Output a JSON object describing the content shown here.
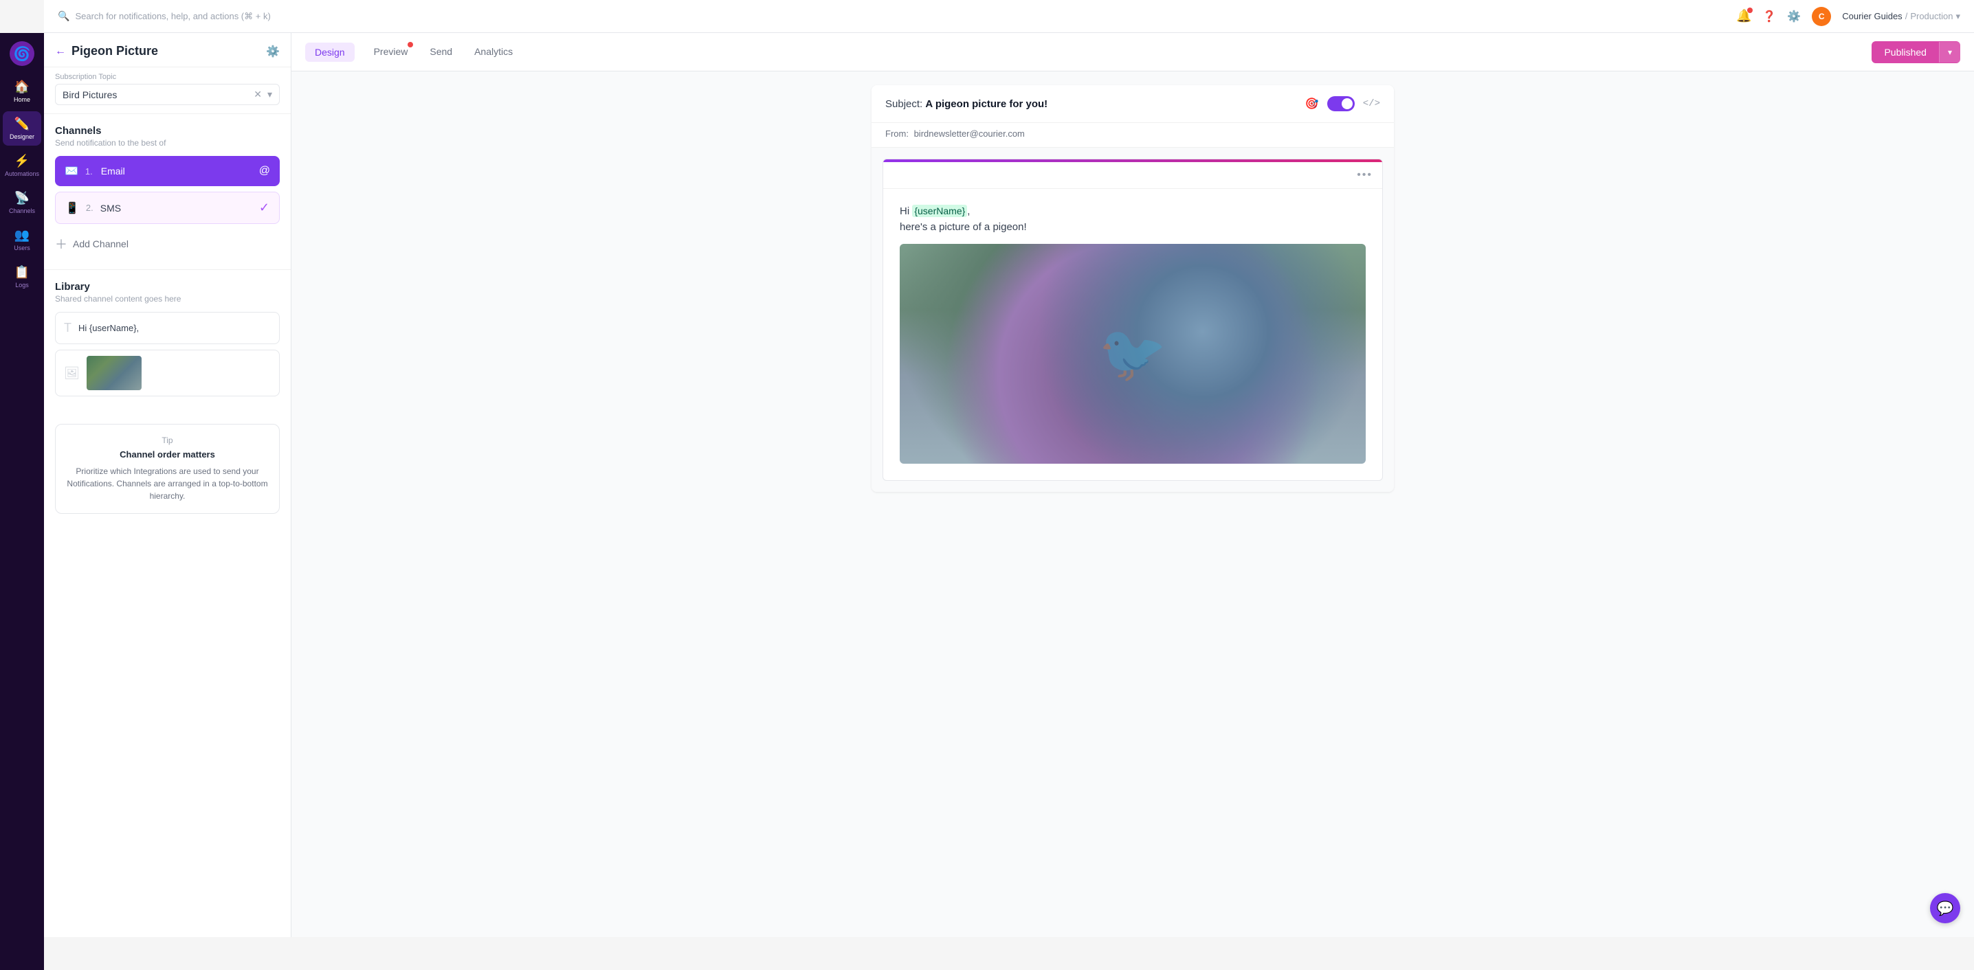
{
  "topbar": {
    "search_placeholder": "Search for notifications, help, and actions (⌘ + k)",
    "user_initial": "C",
    "user_org": "Courier Guides",
    "user_env": "Production"
  },
  "nav": {
    "items": [
      {
        "id": "home",
        "label": "Home",
        "icon": "🏠",
        "active": false
      },
      {
        "id": "designer",
        "label": "Designer",
        "icon": "✏️",
        "active": true
      },
      {
        "id": "automations",
        "label": "Automations",
        "icon": "⚡",
        "active": false
      },
      {
        "id": "channels",
        "label": "Channels",
        "icon": "📡",
        "active": false
      },
      {
        "id": "users",
        "label": "Users",
        "icon": "👥",
        "active": false
      },
      {
        "id": "logs",
        "label": "Logs",
        "icon": "📋",
        "active": false
      }
    ]
  },
  "panel": {
    "back_label": "←",
    "title": "Pigeon Picture",
    "subscription_label": "Subscription Topic",
    "subscription_value": "Bird Pictures",
    "channels_title": "Channels",
    "channels_subtitle": "Send notification to the best of",
    "email_channel_num": "1.",
    "email_channel_name": "Email",
    "sms_channel_num": "2.",
    "sms_channel_name": "SMS",
    "add_channel_label": "Add Channel",
    "library_title": "Library",
    "library_subtitle": "Shared channel content goes here",
    "library_text_item": "Hi {userName},",
    "tip_label": "Tip",
    "tip_title": "Channel order matters",
    "tip_text": "Prioritize which Integrations are used to send your Notifications. Channels are arranged in a top-to-bottom hierarchy."
  },
  "tabs": {
    "design_label": "Design",
    "preview_label": "Preview",
    "send_label": "Send",
    "analytics_label": "Analytics",
    "preview_has_badge": true
  },
  "published_button": {
    "label": "Published",
    "chevron": "▾"
  },
  "email_preview": {
    "subject_prefix": "Subject:",
    "subject_text": "A pigeon picture for you!",
    "from_prefix": "From:",
    "from_email": "birdnewsletter@courier.com",
    "body_hi": "Hi ",
    "username_var": "{userName}",
    "body_text": ",",
    "body_line2": "here's a picture of a pigeon!",
    "code_label": "</>",
    "dots": "•••"
  },
  "colors": {
    "primary": "#7c3aed",
    "published": "#d946a8",
    "email_channel_bg": "#7c3aed",
    "sms_channel_bg": "#fdf4ff",
    "purple_bar": "#9333ea"
  }
}
